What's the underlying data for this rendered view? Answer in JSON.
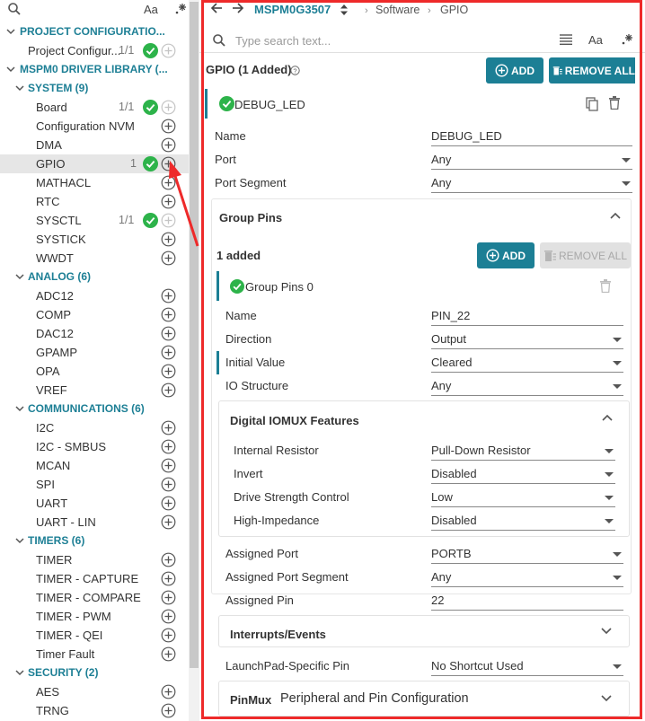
{
  "left": {
    "tools": {
      "search_icon": "search-icon",
      "case_icon_label": "Aa",
      "filter_icon": "sparkle-filter-icon"
    },
    "tree": [
      {
        "type": "hdr",
        "level": 0,
        "label": "PROJECT CONFIGURATIO..."
      },
      {
        "type": "item",
        "level": 1,
        "label": "Project Configur...",
        "count": "1/1",
        "check": true,
        "plus_disabled": true
      },
      {
        "type": "hdr",
        "level": 0,
        "label": "MSPM0 DRIVER LIBRARY (..."
      },
      {
        "type": "hdr",
        "level": 1,
        "label": "SYSTEM (9)"
      },
      {
        "type": "item",
        "level": 2,
        "label": "Board",
        "count": "1/1",
        "check": true,
        "plus_disabled": true
      },
      {
        "type": "item",
        "level": 2,
        "label": "Configuration NVM"
      },
      {
        "type": "item",
        "level": 2,
        "label": "DMA"
      },
      {
        "type": "item",
        "level": 2,
        "label": "GPIO",
        "count": "1",
        "check": true,
        "selected": true
      },
      {
        "type": "item",
        "level": 2,
        "label": "MATHACL"
      },
      {
        "type": "item",
        "level": 2,
        "label": "RTC"
      },
      {
        "type": "item",
        "level": 2,
        "label": "SYSCTL",
        "count": "1/1",
        "check": true,
        "plus_disabled": true
      },
      {
        "type": "item",
        "level": 2,
        "label": "SYSTICK"
      },
      {
        "type": "item",
        "level": 2,
        "label": "WWDT"
      },
      {
        "type": "hdr",
        "level": 1,
        "label": "ANALOG (6)"
      },
      {
        "type": "item",
        "level": 2,
        "label": "ADC12"
      },
      {
        "type": "item",
        "level": 2,
        "label": "COMP"
      },
      {
        "type": "item",
        "level": 2,
        "label": "DAC12"
      },
      {
        "type": "item",
        "level": 2,
        "label": "GPAMP"
      },
      {
        "type": "item",
        "level": 2,
        "label": "OPA"
      },
      {
        "type": "item",
        "level": 2,
        "label": "VREF"
      },
      {
        "type": "hdr",
        "level": 1,
        "label": "COMMUNICATIONS (6)"
      },
      {
        "type": "item",
        "level": 2,
        "label": "I2C"
      },
      {
        "type": "item",
        "level": 2,
        "label": "I2C - SMBUS"
      },
      {
        "type": "item",
        "level": 2,
        "label": "MCAN"
      },
      {
        "type": "item",
        "level": 2,
        "label": "SPI"
      },
      {
        "type": "item",
        "level": 2,
        "label": "UART"
      },
      {
        "type": "item",
        "level": 2,
        "label": "UART - LIN"
      },
      {
        "type": "hdr",
        "level": 1,
        "label": "TIMERS (6)"
      },
      {
        "type": "item",
        "level": 2,
        "label": "TIMER"
      },
      {
        "type": "item",
        "level": 2,
        "label": "TIMER - CAPTURE"
      },
      {
        "type": "item",
        "level": 2,
        "label": "TIMER - COMPARE"
      },
      {
        "type": "item",
        "level": 2,
        "label": "TIMER - PWM"
      },
      {
        "type": "item",
        "level": 2,
        "label": "TIMER - QEI"
      },
      {
        "type": "item",
        "level": 2,
        "label": "Timer Fault"
      },
      {
        "type": "hdr",
        "level": 1,
        "label": "SECURITY (2)"
      },
      {
        "type": "item",
        "level": 2,
        "label": "AES"
      },
      {
        "type": "item",
        "level": 2,
        "label": "TRNG"
      }
    ]
  },
  "breadcrumb": {
    "device": "MSPM0G3507",
    "software": "Software",
    "gpio": "GPIO"
  },
  "search": {
    "placeholder": "Type search text...",
    "case_label": "Aa"
  },
  "gpio": {
    "title": "GPIO (1 Added)",
    "add_label": "ADD",
    "remove_all_label": "REMOVE ALL",
    "instance_name": "DEBUG_LED",
    "fields": [
      {
        "label": "Name",
        "value": "DEBUG_LED",
        "dropdown": false
      },
      {
        "label": "Port",
        "value": "Any",
        "dropdown": true
      },
      {
        "label": "Port Segment",
        "value": "Any",
        "dropdown": true
      }
    ]
  },
  "group_pins": {
    "title": "Group Pins",
    "added_text": "1 added",
    "add_label": "ADD",
    "remove_all_label": "REMOVE ALL",
    "pin_group_name": "Group Pins 0",
    "fields": [
      {
        "label": "Name",
        "value": "PIN_22",
        "dropdown": false
      },
      {
        "label": "Direction",
        "value": "Output",
        "dropdown": true
      },
      {
        "label": "Initial Value",
        "value": "Cleared",
        "dropdown": true,
        "marked": true
      },
      {
        "label": "IO Structure",
        "value": "Any",
        "dropdown": true
      }
    ]
  },
  "iomux": {
    "title": "Digital IOMUX Features",
    "fields": [
      {
        "label": "Internal Resistor",
        "value": "Pull-Down Resistor",
        "dropdown": true
      },
      {
        "label": "Invert",
        "value": "Disabled",
        "dropdown": true
      },
      {
        "label": "Drive Strength Control",
        "value": "Low",
        "dropdown": true
      },
      {
        "label": "High-Impedance",
        "value": "Disabled",
        "dropdown": true
      }
    ]
  },
  "assigned": {
    "fields": [
      {
        "label": "Assigned Port",
        "value": "PORTB",
        "dropdown": true
      },
      {
        "label": "Assigned Port Segment",
        "value": "Any",
        "dropdown": true
      },
      {
        "label": "Assigned Pin",
        "value": "22",
        "dropdown": false
      }
    ]
  },
  "interrupts": {
    "title": "Interrupts/Events"
  },
  "launchpad": {
    "label": "LaunchPad-Specific Pin",
    "value": "No Shortcut Used"
  },
  "pinmux": {
    "title": "PinMux",
    "subtitle": "Peripheral and Pin Configuration"
  },
  "colors": {
    "accent": "#1c7f95",
    "check": "#2db34a",
    "highlight_frame": "#ee2a2a",
    "arrow": "#ee2a2a"
  }
}
